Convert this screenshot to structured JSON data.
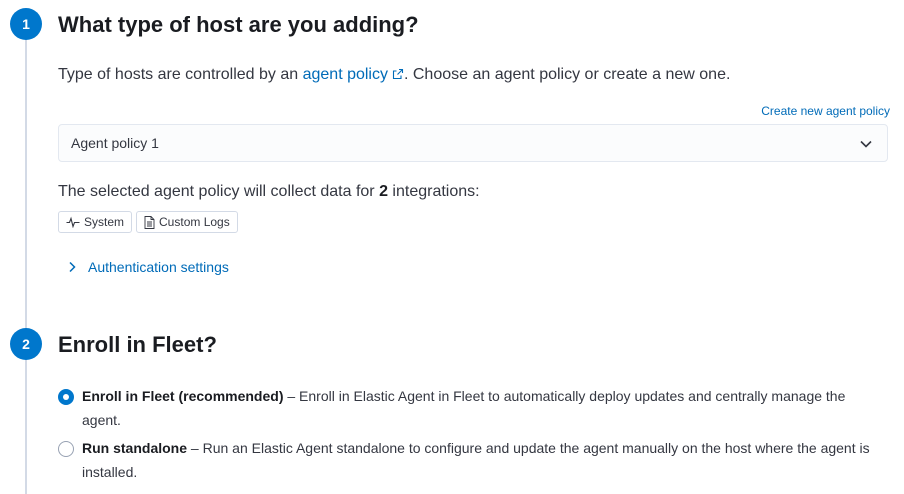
{
  "step1": {
    "number": "1",
    "title": "What type of host are you adding?",
    "desc_prefix": "Type of hosts are controlled by an ",
    "desc_link": "agent policy",
    "desc_suffix": ". Choose an agent policy or create a new one.",
    "create_link": "Create new agent policy",
    "policy_select": {
      "value": "Agent policy 1"
    },
    "collect_prefix": "The selected agent policy will collect data for ",
    "collect_count": "2",
    "collect_suffix": " integrations:",
    "integrations": [
      {
        "label": "System",
        "icon": "heartbeat-icon"
      },
      {
        "label": "Custom Logs",
        "icon": "document-icon"
      }
    ],
    "auth_label": "Authentication settings"
  },
  "step2": {
    "number": "2",
    "title": "Enroll in Fleet?",
    "options": [
      {
        "title": "Enroll in Fleet (recommended)",
        "desc": " – Enroll in Elastic Agent in Fleet to automatically deploy updates and centrally manage the agent.",
        "selected": true
      },
      {
        "title": "Run standalone",
        "desc": " – Run an Elastic Agent standalone to configure and update the agent manually on the host where the agent is installed.",
        "selected": false
      }
    ]
  },
  "colors": {
    "accent": "#0077cc",
    "link": "#006bb8",
    "text": "#343741",
    "heading": "#1a1c21"
  }
}
